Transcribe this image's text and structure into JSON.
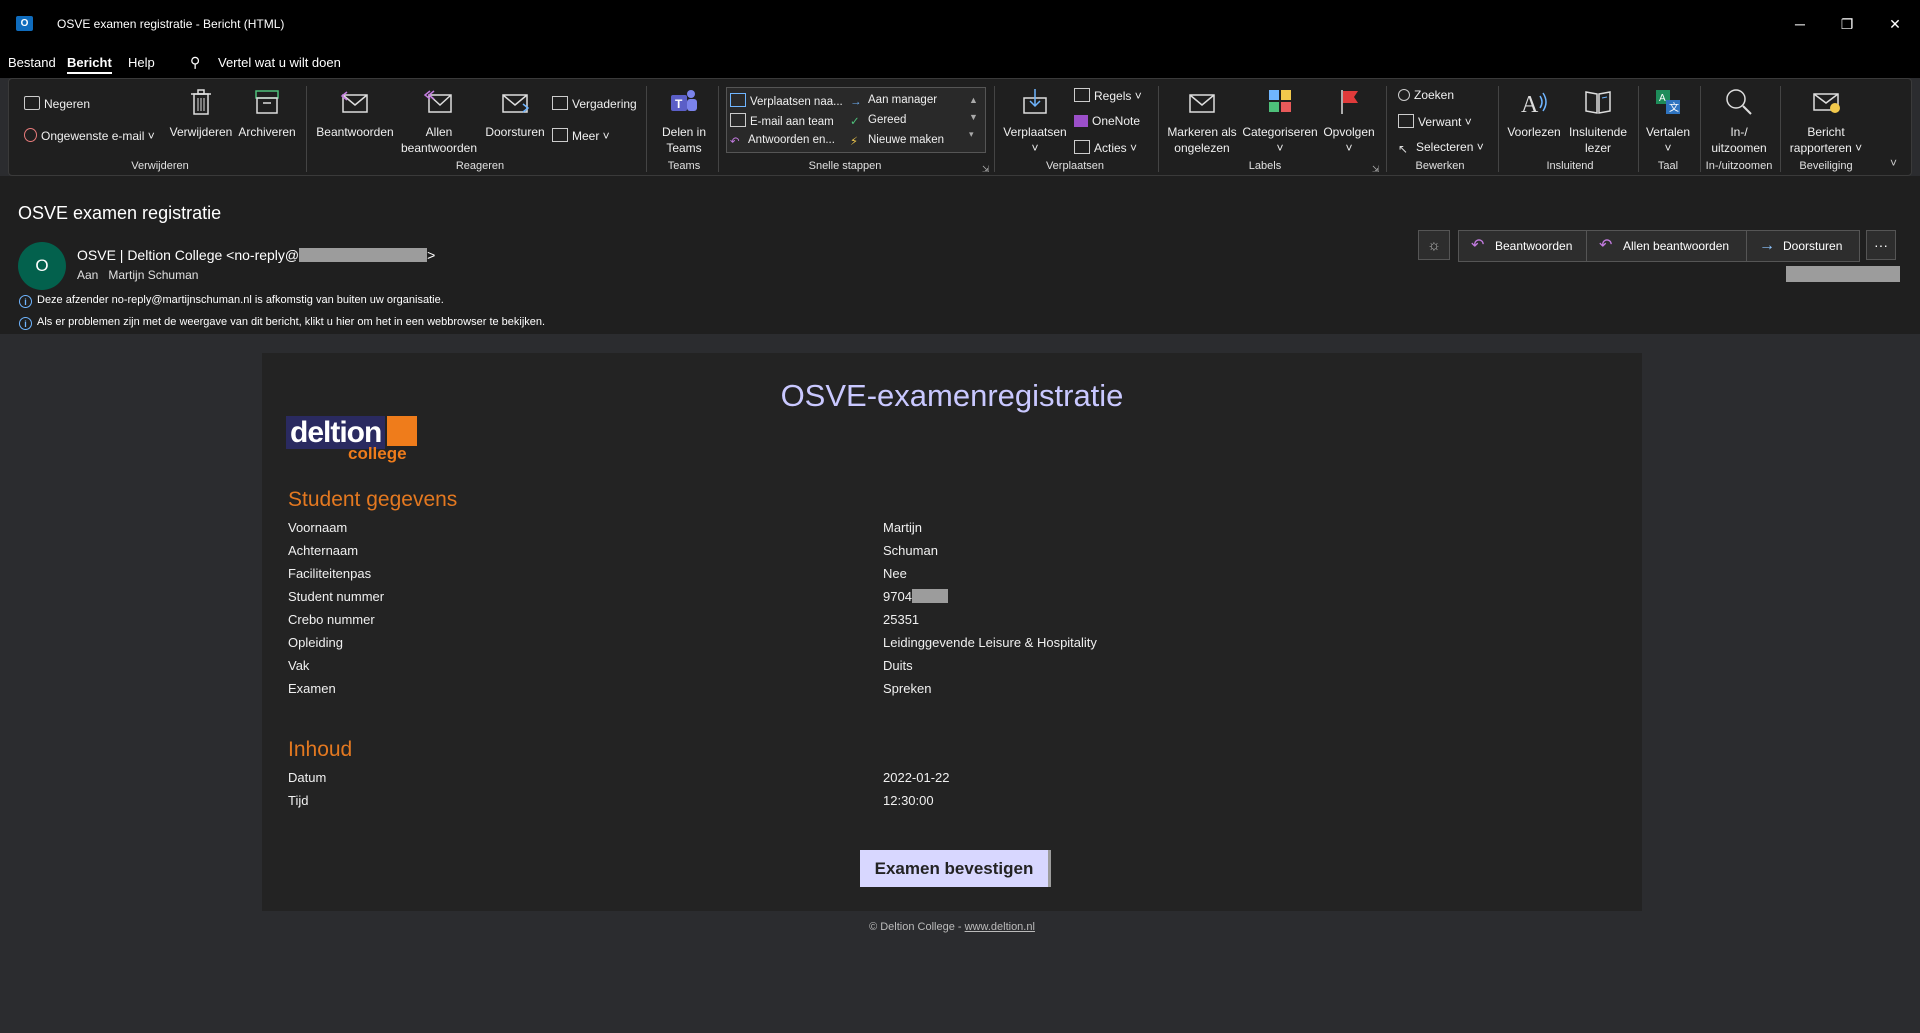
{
  "window": {
    "title": "OSVE examen registratie  -  Bericht (HTML)",
    "app_icon_letter": "O",
    "controls": [
      "─",
      "❐",
      "✕"
    ]
  },
  "menu": {
    "items": [
      "Bestand",
      "Bericht",
      "Help"
    ],
    "active": "Bericht",
    "tell_me": "Vertel wat u wilt doen"
  },
  "ribbon": {
    "verwijderen_group": {
      "label": "Verwijderen",
      "negeren": "Negeren",
      "ongewenste": "Ongewenste e-mail",
      "verwijderen": "Verwijderen",
      "archiveren": "Archiveren"
    },
    "reageren_group": {
      "label": "Reageren",
      "beantwoorden": "Beantwoorden",
      "allen_1": "Allen",
      "allen_2": "beantwoorden",
      "doorsturen": "Doorsturen",
      "vergadering": "Vergadering",
      "meer": "Meer"
    },
    "teams_group": {
      "label": "Teams",
      "delen_1": "Delen in",
      "delen_2": "Teams"
    },
    "snelle_group": {
      "label": "Snelle stappen",
      "items": [
        "Verplaatsen naa...",
        "E-mail aan team",
        "Antwoorden en...",
        "Aan manager",
        "Gereed",
        "Nieuwe maken"
      ]
    },
    "verplaatsen_group": {
      "label": "Verplaatsen",
      "verplaatsen": "Verplaatsen",
      "regels": "Regels",
      "onenote": "OneNote",
      "acties": "Acties"
    },
    "labels_group": {
      "label": "Labels",
      "markeren_1": "Markeren als",
      "markeren_2": "ongelezen",
      "categoriseren": "Categoriseren",
      "opvolgen": "Opvolgen"
    },
    "bewerken_group": {
      "label": "Bewerken",
      "zoeken": "Zoeken",
      "verwant": "Verwant",
      "selecteren": "Selecteren"
    },
    "insluitend_group": {
      "label": "Insluitend",
      "voorlezen": "Voorlezen",
      "insluitende_1": "Insluitende",
      "insluitende_2": "lezer"
    },
    "taal_group": {
      "label": "Taal",
      "vertalen": "Vertalen"
    },
    "zoom_group": {
      "label": "In-/uitzoomen",
      "zoom_1": "In-/",
      "zoom_2": "uitzoomen"
    },
    "beveiliging_group": {
      "label": "Beveiliging",
      "bericht_1": "Bericht",
      "bericht_2": "rapporteren"
    }
  },
  "message": {
    "subject": "OSVE examen registratie",
    "avatar_letter": "O",
    "sender_prefix": "OSVE | Deltion College <no-reply@",
    "sender_suffix": ">",
    "to_label": "Aan",
    "to_name": "Martijn Schuman",
    "info_1": "Deze afzender no-reply@martijnschuman.nl is afkomstig van buiten uw organisatie.",
    "info_2": "Als er problemen zijn met de weergave van dit bericht, klikt u hier om het in een webbrowser te bekijken.",
    "actions": {
      "beantwoorden": "Beantwoorden",
      "allen_beantwoorden": "Allen beantwoorden",
      "doorsturen": "Doorsturen",
      "more": "···"
    }
  },
  "email": {
    "title": "OSVE-examenregistratie",
    "logo_main": "deltion",
    "logo_sub": "college",
    "section_student": "Student gegevens",
    "student_rows": [
      {
        "label": "Voornaam",
        "value": "Martijn"
      },
      {
        "label": "Achternaam",
        "value": "Schuman"
      },
      {
        "label": "Faciliteitenpas",
        "value": "Nee"
      },
      {
        "label": "Student nummer",
        "value": "9704"
      },
      {
        "label": "Crebo nummer",
        "value": "25351"
      },
      {
        "label": "Opleiding",
        "value": "Leidinggevende Leisure & Hospitality"
      },
      {
        "label": "Vak",
        "value": "Duits"
      },
      {
        "label": "Examen",
        "value": "Spreken"
      }
    ],
    "section_inhoud": "Inhoud",
    "inhoud_rows": [
      {
        "label": "Datum",
        "value": "2022-01-22"
      },
      {
        "label": "Tijd",
        "value": "12:30:00"
      }
    ],
    "confirm_button": "Examen bevestigen",
    "footer_text": "© Deltion College - ",
    "footer_link": "www.deltion.nl"
  },
  "colors": {
    "accent_blue": "#8cc4ff",
    "title_lavender": "#c9c8ff",
    "section_orange": "#e37820",
    "button_bg": "#d8d7ff",
    "avatar_green": "#03614d"
  }
}
